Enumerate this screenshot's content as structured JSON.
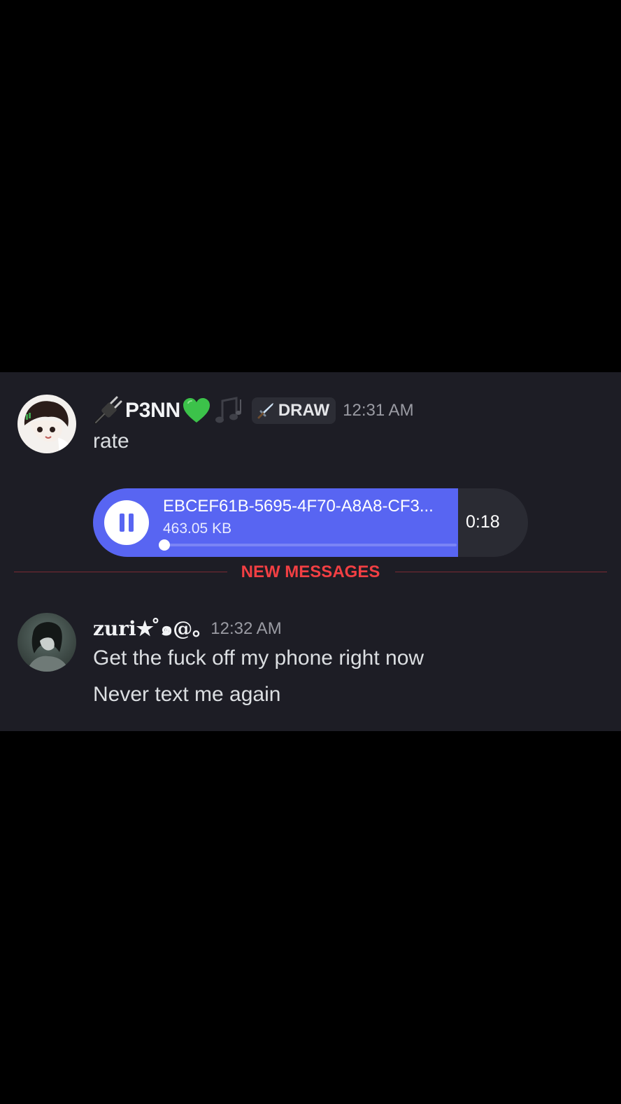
{
  "colors": {
    "chat_background": "#1d1d25",
    "accent": "#5865f2",
    "new_messages": "#f23f43",
    "tag_background": "#2c2d35"
  },
  "messages": [
    {
      "username": "P3NN",
      "username_icons": [
        "plug-icon",
        "green-heart-icon",
        "music-notes-icon"
      ],
      "tag": {
        "icon": "sword-icon",
        "label": "DRAW"
      },
      "timestamp": "12:31 AM",
      "lines": [
        "rate"
      ],
      "voice_attachment": {
        "file_name": "EBCEF61B-5695-4F70-A8A8-CF3...",
        "file_size": "463.05 KB",
        "duration": "0:18",
        "state": "playing",
        "played_fraction": 0.84,
        "playhead_fraction": 0.0
      }
    },
    {
      "username": "zuri★ ̊๑@｡",
      "timestamp": "12:32 AM",
      "lines": [
        "Get the fuck off my phone right now",
        "Never text me again"
      ]
    }
  ],
  "divider": {
    "label": "NEW MESSAGES"
  }
}
